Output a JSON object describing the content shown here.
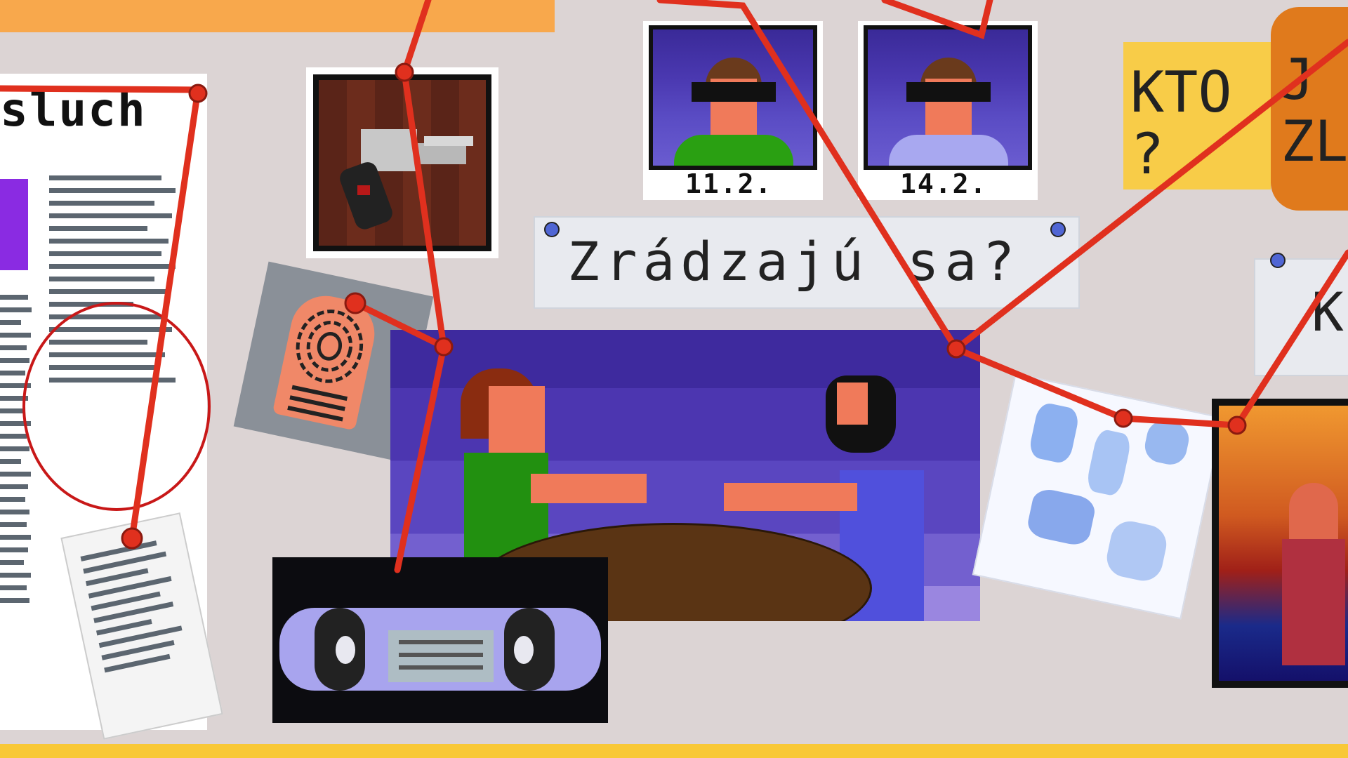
{
  "board": {
    "newspaper_headline": "sluch",
    "fingerprint_label": "",
    "suspects": [
      {
        "date": "11.2."
      },
      {
        "date": "14.2."
      }
    ],
    "question_card": "Zrádzajú sa?",
    "sticky_note": "KTO\n?",
    "orange_note": "J\nZL",
    "right_card_partial": "K"
  },
  "colors": {
    "string": "#e0301e",
    "board_background": "#dcd4d4",
    "rail_yellow": "#f8c836",
    "rail_orange": "#f8a84c",
    "pin": "#5066d4"
  },
  "icons": [
    "pin-icon",
    "revolver-icon",
    "fingerprint-icon",
    "vhs-cassette-icon",
    "map-icon"
  ]
}
